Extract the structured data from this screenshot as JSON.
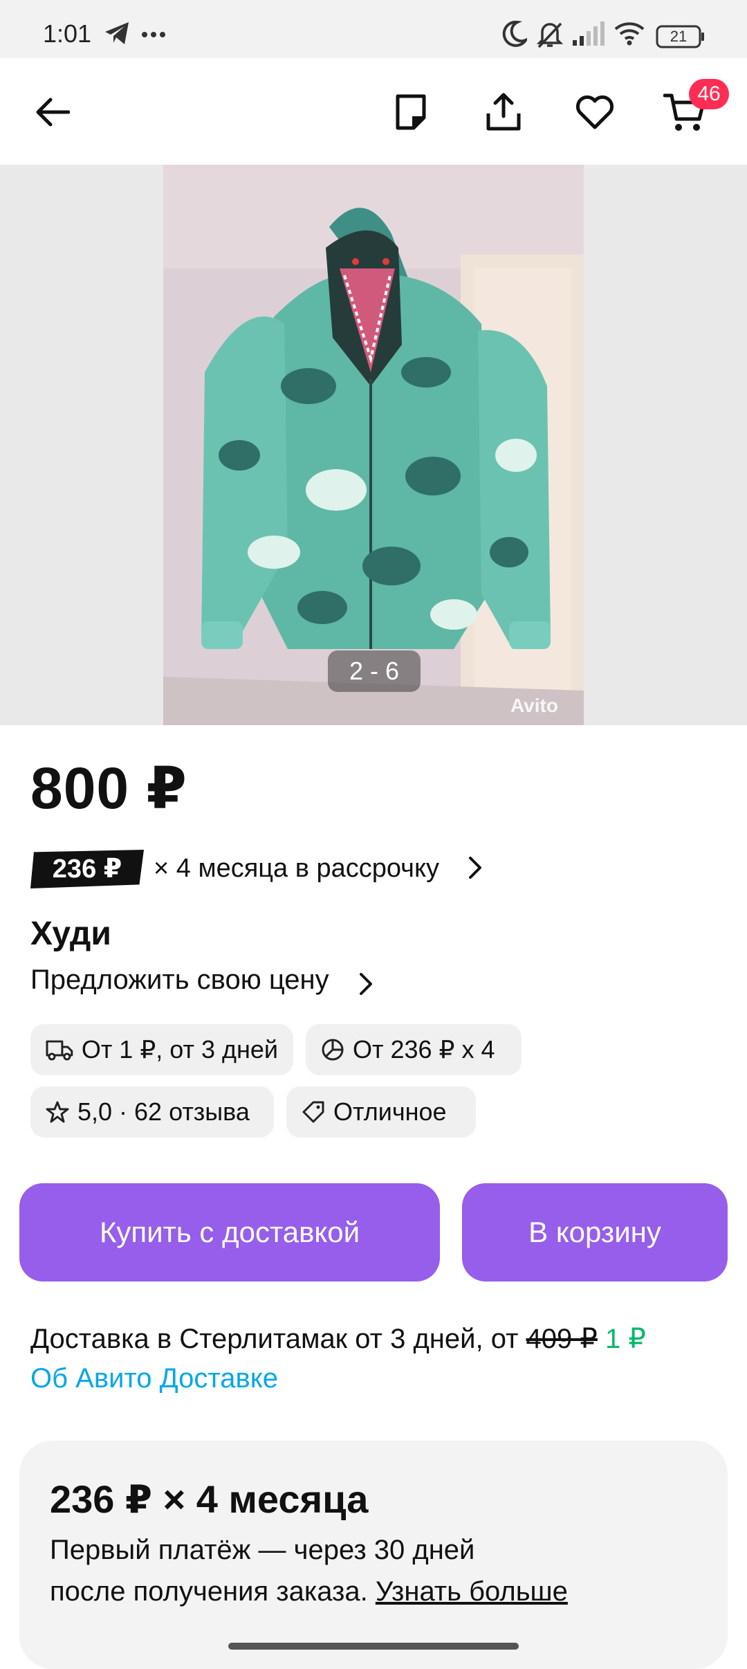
{
  "status_bar": {
    "time": "1:01",
    "battery": "21",
    "icons": [
      "telegram-icon",
      "more-dots-icon",
      "moon-icon",
      "bell-off-icon",
      "signal-icon",
      "wifi-icon",
      "battery-icon"
    ]
  },
  "toolbar": {
    "icons": [
      "back-arrow-icon",
      "note-icon",
      "share-icon",
      "heart-icon",
      "cart-icon"
    ],
    "cart_count": "46"
  },
  "gallery": {
    "counter": "2 - 6",
    "watermark": "Avito"
  },
  "listing": {
    "price": "800 ₽",
    "installment_amount": "236 ₽",
    "installment_text": "× 4 месяца в рассрочку",
    "title": "Худи",
    "offer_price_link": "Предложить свою цену"
  },
  "chips": [
    {
      "icon": "truck-icon",
      "label": "От 1 ₽, от 3 дней"
    },
    {
      "icon": "pie-chart-icon",
      "label": "От 236 ₽ х 4"
    },
    {
      "icon": "star-icon",
      "label": "5,0 · 62 отзыва"
    },
    {
      "icon": "tag-icon",
      "label": "Отличное"
    }
  ],
  "buttons": {
    "buy": "Купить с доставкой",
    "cart": "В корзину"
  },
  "delivery": {
    "text": "Доставка в Стерлитамак от 3 дней, от ",
    "old_price": "409 ₽",
    "new_price": "1 ₽",
    "about_link": "Об Авито Доставке"
  },
  "installment_card": {
    "title": "236 ₽ × 4 месяца",
    "line1": "Первый платёж — через 30 дней",
    "line2": "после получения заказа. ",
    "more_link": "Узнать больше"
  },
  "colors": {
    "accent": "#965eeb",
    "badge": "#ff2d55",
    "link": "#06a7e6",
    "discount_price": "#02b86b"
  }
}
